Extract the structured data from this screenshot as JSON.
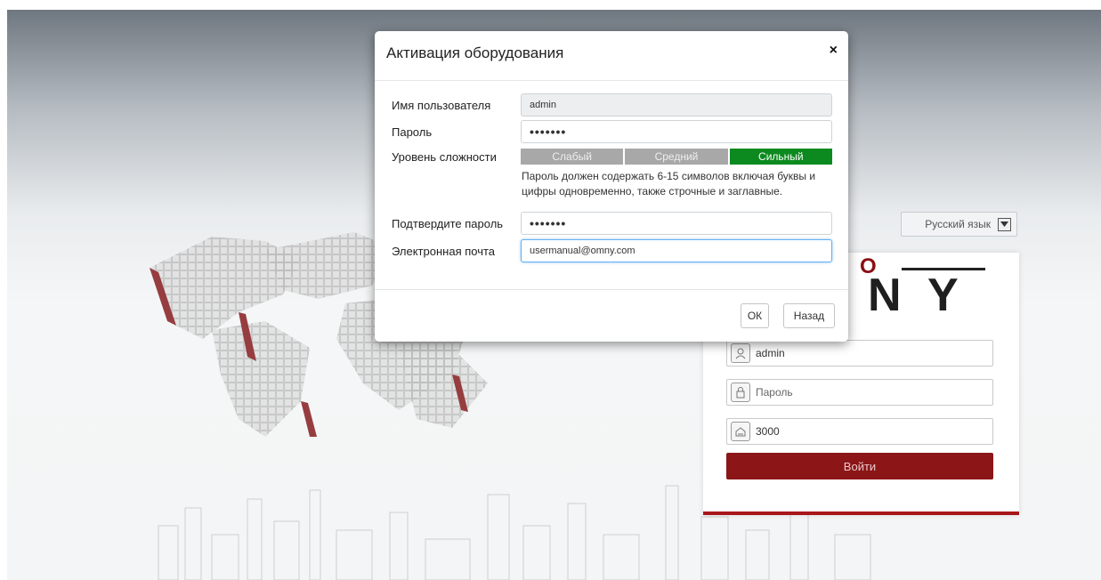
{
  "language_select": {
    "value": "Русский язык"
  },
  "login": {
    "brand_top": "R O",
    "brand_main": "N Y",
    "username_value": "admin",
    "password_placeholder": "Пароль",
    "port_value": "3000",
    "login_button": "Войти"
  },
  "modal": {
    "title": "Активация оборудования",
    "close_symbol": "×",
    "fields": {
      "username": {
        "label": "Имя пользователя",
        "value": "admin"
      },
      "password": {
        "label": "Пароль",
        "value": "•••••••"
      },
      "strength": {
        "label": "Уровень сложности",
        "weak": "Слабый",
        "medium": "Средний",
        "strong": "Сильный",
        "level": "strong"
      },
      "hint": "Пароль должен содержать 6-15 символов включая буквы и цифры одновременно, также строчные и заглавные.",
      "confirm": {
        "label": "Подтвердите пароль",
        "value": "•••••••"
      },
      "email": {
        "label": "Электронная почта",
        "value": "usermanual@omny.com"
      }
    },
    "buttons": {
      "ok": "ОК",
      "back": "Назад"
    }
  },
  "colors": {
    "brand_red": "#8b1517",
    "strength_strong": "#0c8a1f",
    "strength_inactive": "#a8a8a8"
  }
}
